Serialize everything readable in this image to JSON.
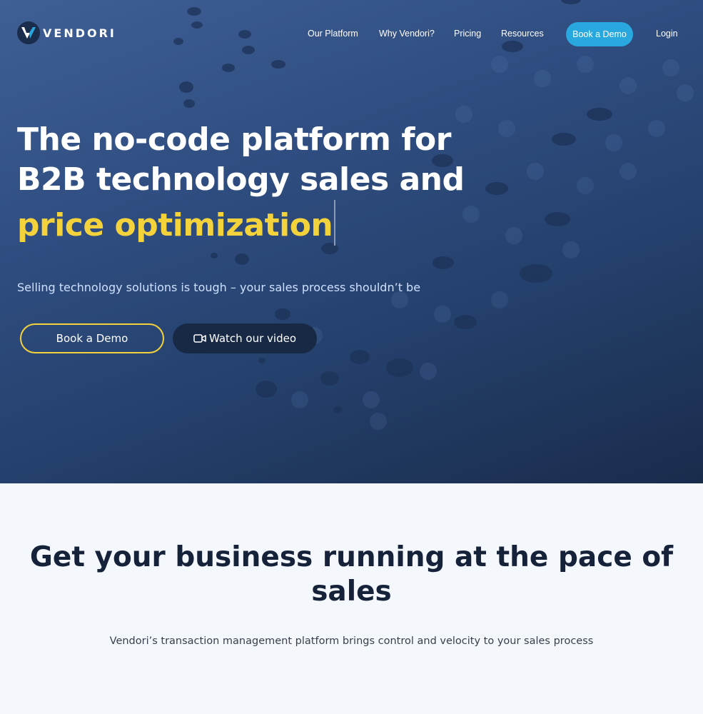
{
  "brand": {
    "name": "VENDORI",
    "accent_color": "#29a8e0",
    "highlight_color": "#f4d23b"
  },
  "nav": {
    "items": [
      {
        "label": "Our Platform"
      },
      {
        "label": "Why Vendori?"
      },
      {
        "label": "Pricing"
      },
      {
        "label": "Resources"
      }
    ],
    "cta_label": "Book a Demo",
    "login_label": "Login"
  },
  "hero": {
    "headline_line1": "The no-code platform for",
    "headline_line2": "B2B technology sales and",
    "headline_highlight": "price optimization",
    "subheadline": "Selling technology solutions is tough – your sales process shouldn’t be",
    "primary_button": "Book a Demo",
    "secondary_button": "Watch our video",
    "secondary_icon": "video-camera-icon"
  },
  "section": {
    "title": "Get your business running at the pace of sales",
    "subtitle": "Vendori’s transaction management platform brings control and velocity to your sales process"
  }
}
